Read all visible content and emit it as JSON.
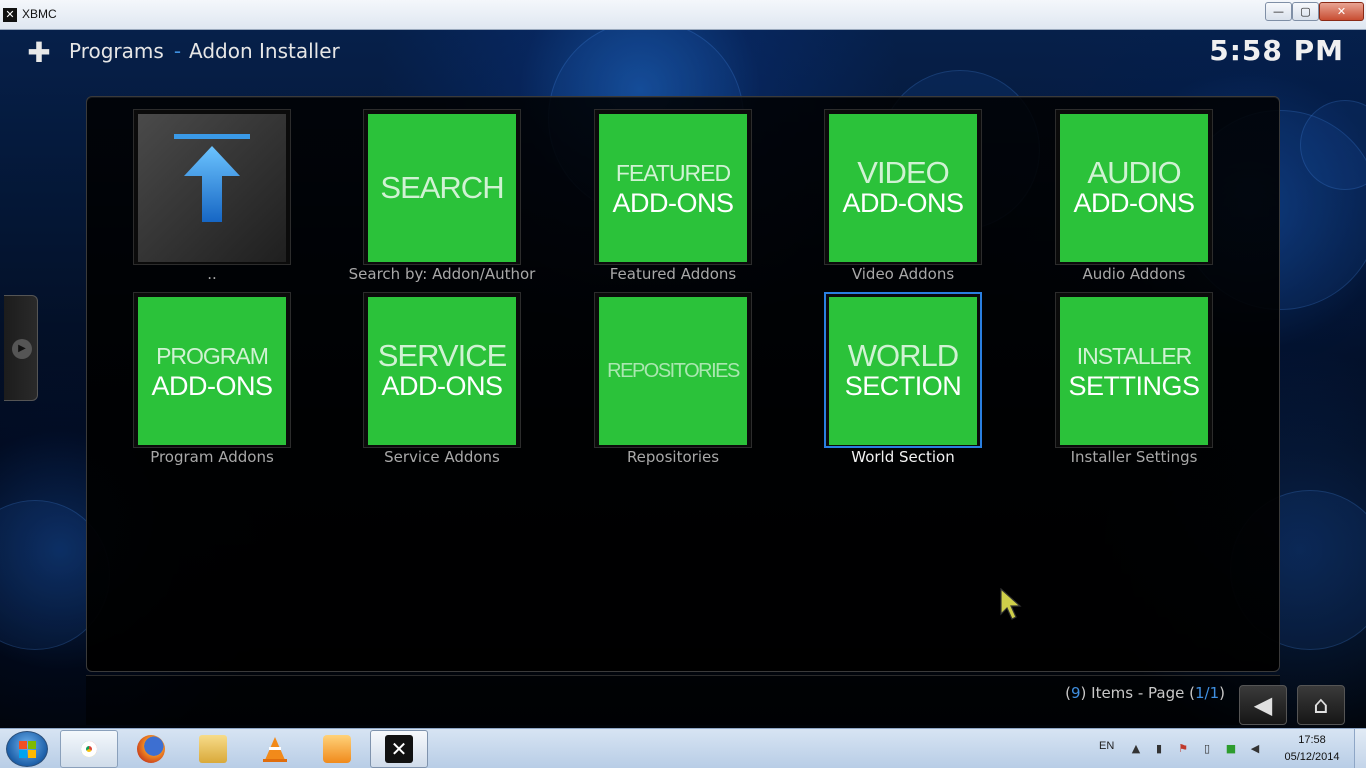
{
  "window": {
    "app_icon": "xbmc-icon",
    "title": "XBMC",
    "controls": {
      "minimize": "—",
      "maximize": "▢",
      "close": "✕"
    }
  },
  "header": {
    "icon": "puzzle-icon",
    "section": "Programs",
    "separator": "-",
    "page": "Addon Installer",
    "clock": "5:58 PM"
  },
  "items": [
    {
      "id": "parent",
      "label": "..",
      "tile_type": "up-arrow",
      "tile_line1": "",
      "tile_line2": ""
    },
    {
      "id": "search",
      "label": "Search by: Addon/Author",
      "tile_line1": "SEARCH",
      "tile_line2": ""
    },
    {
      "id": "featured",
      "label": "Featured Addons",
      "tile_line1": "FEATURED",
      "tile_line2": "ADD-ONS"
    },
    {
      "id": "video",
      "label": "Video Addons",
      "tile_line1": "VIDEO",
      "tile_line2": "ADD-ONS"
    },
    {
      "id": "audio",
      "label": "Audio Addons",
      "tile_line1": "AUDIO",
      "tile_line2": "ADD-ONS"
    },
    {
      "id": "program",
      "label": "Program Addons",
      "tile_line1": "PROGRAM",
      "tile_line2": "ADD-ONS"
    },
    {
      "id": "service",
      "label": "Service Addons",
      "tile_line1": "SERVICE",
      "tile_line2": "ADD-ONS"
    },
    {
      "id": "repositories",
      "label": "Repositories",
      "tile_line1": "REPOSITORIES",
      "tile_line2": ""
    },
    {
      "id": "world",
      "label": "World Section",
      "tile_line1": "WORLD",
      "tile_line2": "SECTION",
      "selected": true
    },
    {
      "id": "installer",
      "label": "Installer Settings",
      "tile_line1": "INSTALLER",
      "tile_line2": "SETTINGS"
    }
  ],
  "footer": {
    "count_open": "(",
    "count": "9",
    "count_mid": ") Items - Page (",
    "page": "1/1",
    "count_close": ")",
    "back_icon": "back-arrow-icon",
    "home_icon": "home-icon"
  },
  "colors": {
    "tile_green": "#2bc23a",
    "accent_blue": "#3f8fe0",
    "selection_border": "#2a7fe0"
  },
  "taskbar": {
    "apps": [
      {
        "name": "chrome",
        "icon": "chrome-icon",
        "active": true
      },
      {
        "name": "firefox",
        "icon": "firefox-icon"
      },
      {
        "name": "explorer",
        "icon": "folder-icon"
      },
      {
        "name": "vlc",
        "icon": "vlc-cone-icon"
      },
      {
        "name": "media-player",
        "icon": "media-player-icon"
      },
      {
        "name": "xbmc",
        "icon": "xbmc-icon",
        "active": true
      }
    ],
    "tray": {
      "language": "EN",
      "time": "17:58",
      "date": "05/12/2014"
    }
  }
}
